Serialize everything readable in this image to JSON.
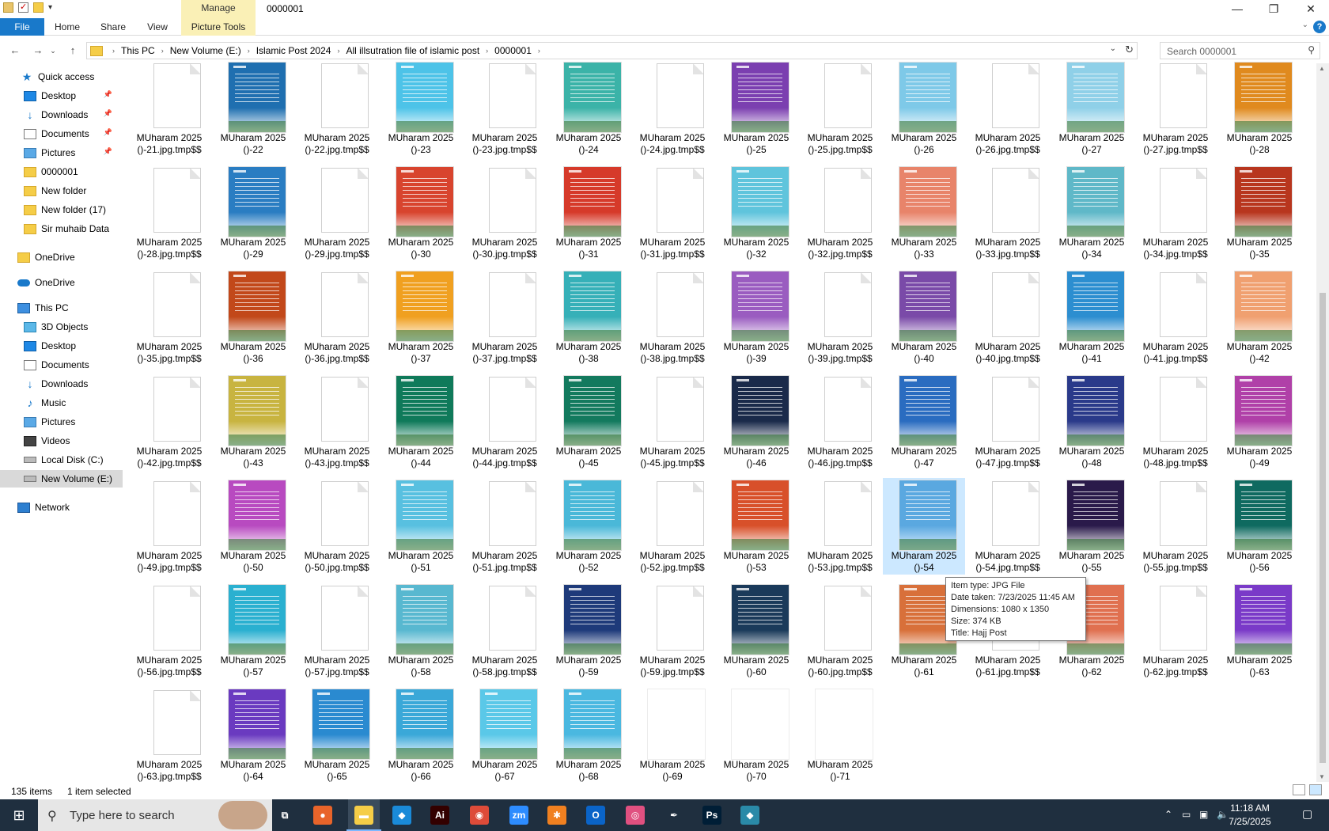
{
  "window": {
    "title": "0000001",
    "manage_tab": "Manage",
    "controls": {
      "minimize": "—",
      "maximize": "❐",
      "close": "✕"
    }
  },
  "ribbon": {
    "tabs": [
      "File",
      "Home",
      "Share",
      "View",
      "Picture Tools"
    ],
    "help": "?"
  },
  "address": {
    "crumbs": [
      "This PC",
      "New Volume (E:)",
      "Islamic Post 2024",
      "All illsutration file of islamic post",
      "0000001"
    ],
    "search_placeholder": "Search 0000001"
  },
  "sidebar": {
    "items": [
      {
        "label": "Quick access",
        "icon": "star-icon",
        "pinned": false
      },
      {
        "label": "Desktop",
        "icon": "desktop-icon",
        "pinned": true
      },
      {
        "label": "Downloads",
        "icon": "download-icon",
        "pinned": true
      },
      {
        "label": "Documents",
        "icon": "documents-icon",
        "pinned": true
      },
      {
        "label": "Pictures",
        "icon": "pictures-icon",
        "pinned": true
      },
      {
        "label": "0000001",
        "icon": "folder-icon",
        "pinned": false
      },
      {
        "label": "New folder",
        "icon": "folder-icon",
        "pinned": false
      },
      {
        "label": "New folder (17)",
        "icon": "folder-icon",
        "pinned": false
      },
      {
        "label": "Sir muhaib Data",
        "icon": "folder-icon",
        "pinned": false
      },
      {
        "label": "OneDrive",
        "icon": "folder-icon",
        "pinned": false
      },
      {
        "label": "OneDrive",
        "icon": "cloud-icon",
        "pinned": false
      },
      {
        "label": "This PC",
        "icon": "computer-icon",
        "pinned": false
      },
      {
        "label": "3D Objects",
        "icon": "3d-objects-icon",
        "pinned": false
      },
      {
        "label": "Desktop",
        "icon": "desktop-icon",
        "pinned": false
      },
      {
        "label": "Documents",
        "icon": "documents-icon",
        "pinned": false
      },
      {
        "label": "Downloads",
        "icon": "download-icon",
        "pinned": false
      },
      {
        "label": "Music",
        "icon": "music-icon",
        "pinned": false
      },
      {
        "label": "Pictures",
        "icon": "pictures-icon",
        "pinned": false
      },
      {
        "label": "Videos",
        "icon": "videos-icon",
        "pinned": false
      },
      {
        "label": "Local Disk (C:)",
        "icon": "drive-icon",
        "pinned": false
      },
      {
        "label": "New Volume (E:)",
        "icon": "drive-icon",
        "pinned": false,
        "selected": true
      },
      {
        "label": "Network",
        "icon": "network-icon",
        "pinned": false
      }
    ]
  },
  "files": {
    "rows": [
      [
        [
          "MUharam 2025",
          "()-21.jpg.tmp$$",
          "doc"
        ],
        [
          "MUharam 2025",
          "()-22",
          "#1f6fb0"
        ],
        [
          "MUharam 2025",
          "()-22.jpg.tmp$$",
          "doc"
        ],
        [
          "MUharam 2025",
          "()-23",
          "#4dc3e8"
        ],
        [
          "MUharam 2025",
          "()-23.jpg.tmp$$",
          "doc"
        ],
        [
          "MUharam 2025",
          "()-24",
          "#3bb3a8"
        ],
        [
          "MUharam 2025",
          "()-24.jpg.tmp$$",
          "doc"
        ],
        [
          "MUharam 2025",
          "()-25",
          "#7b3fb0"
        ],
        [
          "MUharam 2025",
          "()-25.jpg.tmp$$",
          "doc"
        ],
        [
          "MUharam 2025",
          "()-26",
          "#7ec9e8"
        ],
        [
          "MUharam 2025",
          "()-26.jpg.tmp$$",
          "doc"
        ],
        [
          "MUharam 2025",
          "()-27",
          "#8fd0e8"
        ],
        [
          "MUharam 2025",
          "()-27.jpg.tmp$$",
          "doc"
        ],
        [
          "MUharam 2025",
          "()-28",
          "#e08a1e"
        ]
      ],
      [
        [
          "MUharam 2025",
          "()-28.jpg.tmp$$",
          "doc"
        ],
        [
          "MUharam 2025",
          "()-29",
          "#2a7dc2"
        ],
        [
          "MUharam 2025",
          "()-29.jpg.tmp$$",
          "doc"
        ],
        [
          "MUharam 2025",
          "()-30",
          "#d8442e"
        ],
        [
          "MUharam 2025",
          "()-30.jpg.tmp$$",
          "doc"
        ],
        [
          "MUharam 2025",
          "()-31",
          "#d63a2a"
        ],
        [
          "MUharam 2025",
          "()-31.jpg.tmp$$",
          "doc"
        ],
        [
          "MUharam 2025",
          "()-32",
          "#5fc4dc"
        ],
        [
          "MUharam 2025",
          "()-32.jpg.tmp$$",
          "doc"
        ],
        [
          "MUharam 2025",
          "()-33",
          "#e8846a"
        ],
        [
          "MUharam 2025",
          "()-33.jpg.tmp$$",
          "doc"
        ],
        [
          "MUharam 2025",
          "()-34",
          "#5fb8c8"
        ],
        [
          "MUharam 2025",
          "()-34.jpg.tmp$$",
          "doc"
        ],
        [
          "MUharam 2025",
          "()-35",
          "#b8361e"
        ]
      ],
      [
        [
          "MUharam 2025",
          "()-35.jpg.tmp$$",
          "doc"
        ],
        [
          "MUharam 2025",
          "()-36",
          "#c2481a"
        ],
        [
          "MUharam 2025",
          "()-36.jpg.tmp$$",
          "doc"
        ],
        [
          "MUharam 2025",
          "()-37",
          "#f0a020"
        ],
        [
          "MUharam 2025",
          "()-37.jpg.tmp$$",
          "doc"
        ],
        [
          "MUharam 2025",
          "()-38",
          "#36b0b8"
        ],
        [
          "MUharam 2025",
          "()-38.jpg.tmp$$",
          "doc"
        ],
        [
          "MUharam 2025",
          "()-39",
          "#9a5cc0"
        ],
        [
          "MUharam 2025",
          "()-39.jpg.tmp$$",
          "doc"
        ],
        [
          "MUharam 2025",
          "()-40",
          "#7a4aa8"
        ],
        [
          "MUharam 2025",
          "()-40.jpg.tmp$$",
          "doc"
        ],
        [
          "MUharam 2025",
          "()-41",
          "#2c8ed0"
        ],
        [
          "MUharam 2025",
          "()-41.jpg.tmp$$",
          "doc"
        ],
        [
          "MUharam 2025",
          "()-42",
          "#f0a070"
        ]
      ],
      [
        [
          "MUharam 2025",
          "()-42.jpg.tmp$$",
          "doc"
        ],
        [
          "MUharam 2025",
          "()-43",
          "#c8b440"
        ],
        [
          "MUharam 2025",
          "()-43.jpg.tmp$$",
          "doc"
        ],
        [
          "MUharam 2025",
          "()-44",
          "#0f7a5a"
        ],
        [
          "MUharam 2025",
          "()-44.jpg.tmp$$",
          "doc"
        ],
        [
          "MUharam 2025",
          "()-45",
          "#137a5e"
        ],
        [
          "MUharam 2025",
          "()-45.jpg.tmp$$",
          "doc"
        ],
        [
          "MUharam 2025",
          "()-46",
          "#1a2a4a"
        ],
        [
          "MUharam 2025",
          "()-46.jpg.tmp$$",
          "doc"
        ],
        [
          "MUharam 2025",
          "()-47",
          "#2a6cc0"
        ],
        [
          "MUharam 2025",
          "()-47.jpg.tmp$$",
          "doc"
        ],
        [
          "MUharam 2025",
          "()-48",
          "#2a3a8a"
        ],
        [
          "MUharam 2025",
          "()-48.jpg.tmp$$",
          "doc"
        ],
        [
          "MUharam 2025",
          "()-49",
          "#b040a8"
        ]
      ],
      [
        [
          "MUharam 2025",
          "()-49.jpg.tmp$$",
          "doc"
        ],
        [
          "MUharam 2025",
          "()-50",
          "#b84ac0"
        ],
        [
          "MUharam 2025",
          "()-50.jpg.tmp$$",
          "doc"
        ],
        [
          "MUharam 2025",
          "()-51",
          "#58c0e0"
        ],
        [
          "MUharam 2025",
          "()-51.jpg.tmp$$",
          "doc"
        ],
        [
          "MUharam 2025",
          "()-52",
          "#4ab8d8"
        ],
        [
          "MUharam 2025",
          "()-52.jpg.tmp$$",
          "doc"
        ],
        [
          "MUharam 2025",
          "()-53",
          "#d8502a"
        ],
        [
          "MUharam 2025",
          "()-53.jpg.tmp$$",
          "doc"
        ],
        [
          "MUharam 2025",
          "()-54",
          "#5aa8e0"
        ],
        [
          "MUharam 2025",
          "()-54.jpg.tmp$$",
          "doc"
        ],
        [
          "MUharam 2025",
          "()-55",
          "#2a1a4a"
        ],
        [
          "MUharam 2025",
          "()-55.jpg.tmp$$",
          "doc"
        ],
        [
          "MUharam 2025",
          "()-56",
          "#0f6a60"
        ]
      ],
      [
        [
          "MUharam 2025",
          "()-56.jpg.tmp$$",
          "doc"
        ],
        [
          "MUharam 2025",
          "()-57",
          "#2ab0d0"
        ],
        [
          "MUharam 2025",
          "()-57.jpg.tmp$$",
          "doc"
        ],
        [
          "MUharam 2025",
          "()-58",
          "#58b8d0"
        ],
        [
          "MUharam 2025",
          "()-58.jpg.tmp$$",
          "doc"
        ],
        [
          "MUharam 2025",
          "()-59",
          "#1e3a7a"
        ],
        [
          "MUharam 2025",
          "()-59.jpg.tmp$$",
          "doc"
        ],
        [
          "MUharam 2025",
          "()-60",
          "#1a3a5a"
        ],
        [
          "MUharam 2025",
          "()-60.jpg.tmp$$",
          "doc"
        ],
        [
          "MUharam 2025",
          "()-61",
          "#d8703a"
        ],
        [
          "MUharam 2025",
          "()-61.jpg.tmp$$",
          "doc"
        ],
        [
          "MUharam 2025",
          "()-62",
          "#e07050"
        ],
        [
          "MUharam 2025",
          "()-62.jpg.tmp$$",
          "doc"
        ],
        [
          "MUharam 2025",
          "()-63",
          "#7a3ac8"
        ]
      ],
      [
        [
          "MUharam 2025",
          "()-63.jpg.tmp$$",
          "doc"
        ],
        [
          "MUharam 2025",
          "()-64",
          "#6a3ac0"
        ],
        [
          "MUharam 2025",
          "()-65",
          "#2a8ad0"
        ],
        [
          "MUharam 2025",
          "()-66",
          "#3aa8d8"
        ],
        [
          "MUharam 2025",
          "()-67",
          "#5ac8e8"
        ],
        [
          "MUharam 2025",
          "()-68",
          "#4ab8e0"
        ],
        [
          "MUharam 2025",
          "()-69",
          "white"
        ],
        [
          "MUharam 2025",
          "()-70",
          "white"
        ],
        [
          "MUharam 2025",
          "()-71",
          "white"
        ]
      ]
    ],
    "selected": {
      "row": 4,
      "col": 9
    }
  },
  "tooltip": {
    "lines": [
      "Item type: JPG File",
      "Date taken: 7/23/2025 11:45 AM",
      "Dimensions: 1080 x 1350",
      "Size: 374 KB",
      "Title: Hajj Post"
    ]
  },
  "status": {
    "items_count": "135 items",
    "selection": "1 item selected"
  },
  "taskbar": {
    "search_placeholder": "Type here to search",
    "apps": [
      {
        "name": "task-view-icon",
        "glyph": "⧉",
        "color": "transparent"
      },
      {
        "name": "firefox-icon",
        "glyph": "●",
        "color": "#e8642a"
      },
      {
        "name": "file-explorer-icon",
        "glyph": "▬",
        "color": "#f5cd47"
      },
      {
        "name": "vscode-icon",
        "glyph": "◆",
        "color": "#1a8ad8"
      },
      {
        "name": "illustrator-icon",
        "glyph": "Ai",
        "color": "#330000"
      },
      {
        "name": "chrome-icon",
        "glyph": "◉",
        "color": "#dd4b39"
      },
      {
        "name": "zoom-icon",
        "glyph": "zm",
        "color": "#2d8cff"
      },
      {
        "name": "app-orange-icon",
        "glyph": "✱",
        "color": "#f08020"
      },
      {
        "name": "outlook-icon",
        "glyph": "O",
        "color": "#0a64c8"
      },
      {
        "name": "app-pink-icon",
        "glyph": "◎",
        "color": "#e05080"
      },
      {
        "name": "pen-tool-icon",
        "glyph": "✒",
        "color": "transparent"
      },
      {
        "name": "photoshop-icon",
        "glyph": "Ps",
        "color": "#001e36"
      },
      {
        "name": "app-teal-icon",
        "glyph": "◆",
        "color": "#2a8aa8"
      }
    ],
    "clock_time": "11:18 AM",
    "clock_date": "7/25/2025"
  }
}
